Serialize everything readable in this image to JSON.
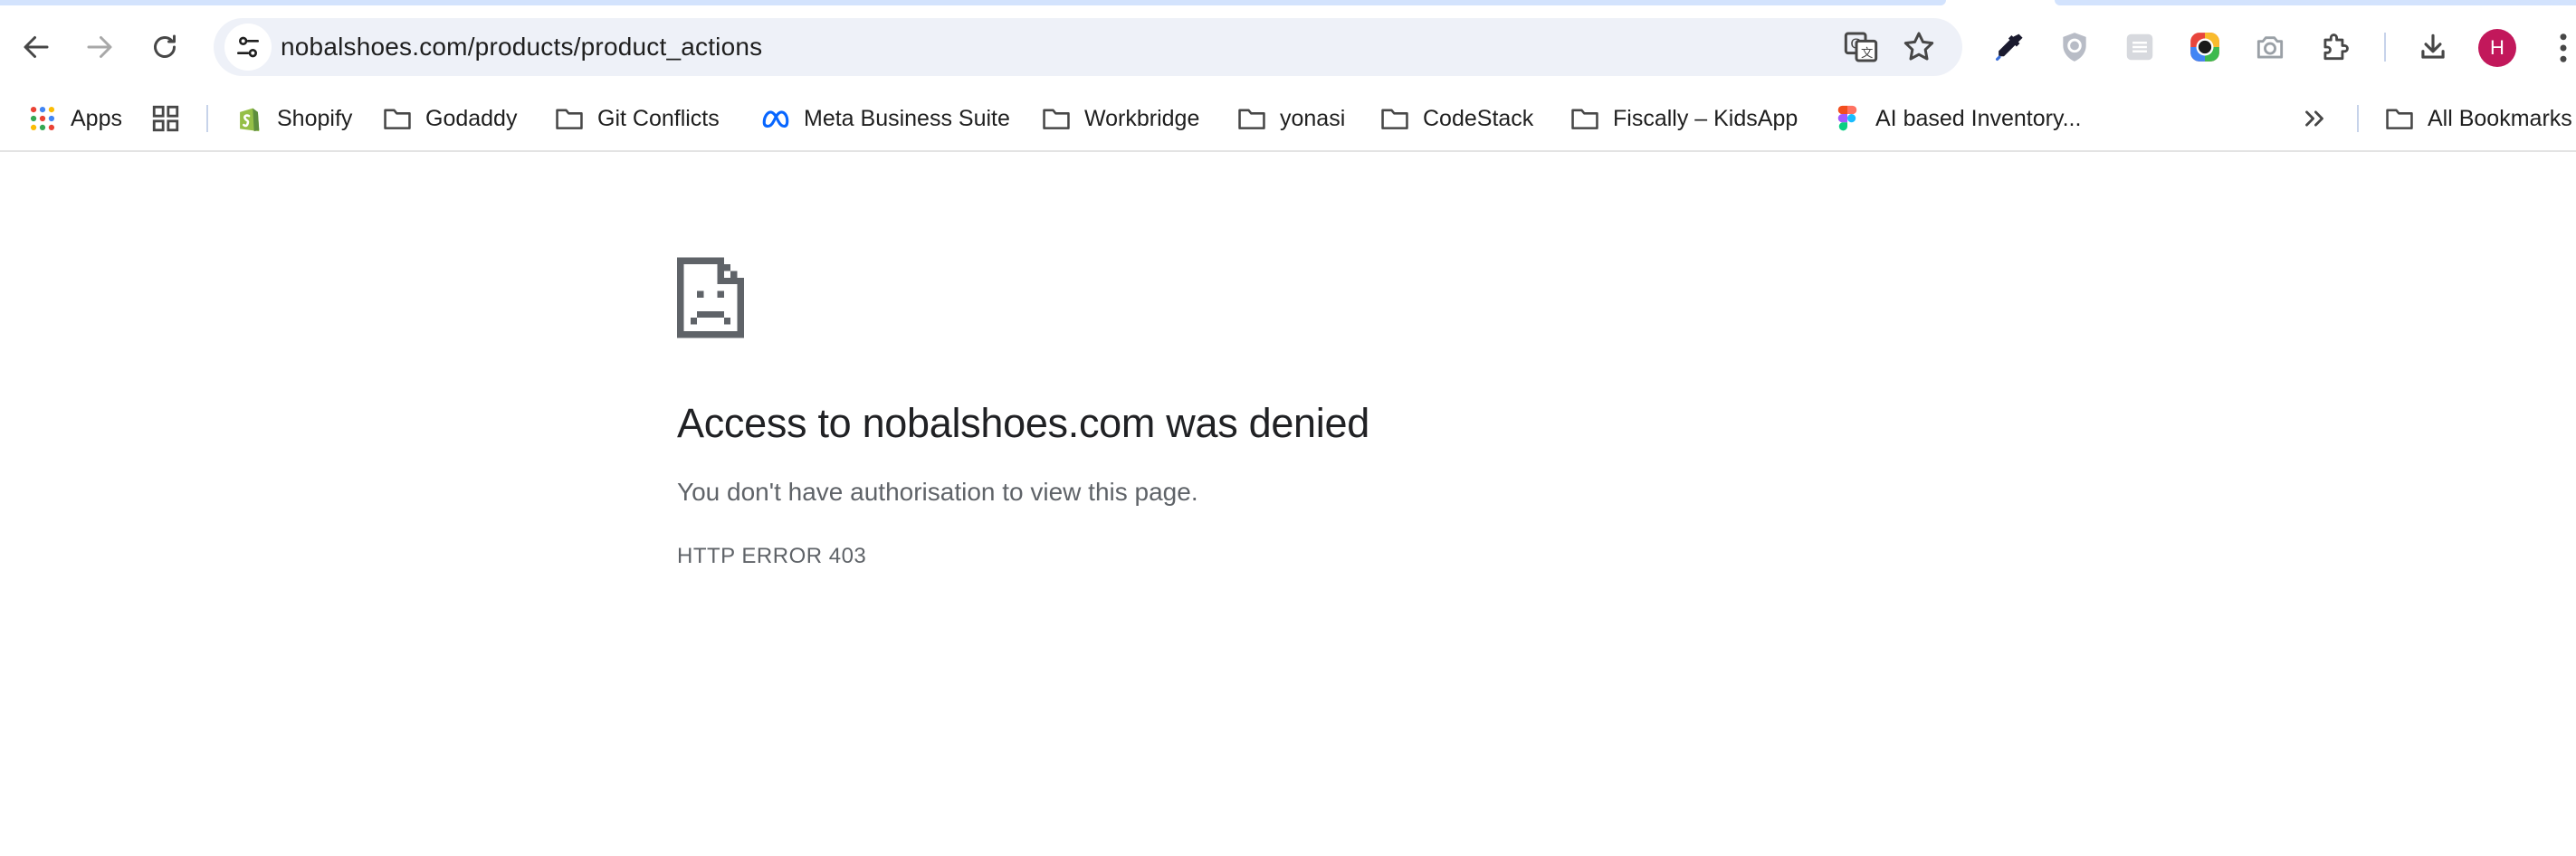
{
  "address_bar": {
    "url": "nobalshoes.com/products/product_actions"
  },
  "profile": {
    "initial": "H"
  },
  "bookmarks": [
    {
      "label": "Apps",
      "icon": "apps-grid-icon"
    },
    {
      "label": "",
      "icon": "tab-groups-icon"
    },
    {
      "label": "Shopify",
      "icon": "shopify-icon"
    },
    {
      "label": "Godaddy",
      "icon": "folder-icon"
    },
    {
      "label": "Git Conflicts",
      "icon": "folder-icon"
    },
    {
      "label": "Meta Business Suite",
      "icon": "meta-icon"
    },
    {
      "label": "Workbridge",
      "icon": "folder-icon"
    },
    {
      "label": "yonasi",
      "icon": "folder-icon"
    },
    {
      "label": "CodeStack",
      "icon": "folder-icon"
    },
    {
      "label": "Fiscally – KidsApp",
      "icon": "folder-icon"
    },
    {
      "label": "AI based Inventory...",
      "icon": "figma-icon"
    },
    {
      "label": "All Bookmarks",
      "icon": "folder-icon"
    }
  ],
  "error_page": {
    "heading": "Access to nobalshoes.com was denied",
    "message": "You don't have authorisation to view this page.",
    "error_code": "HTTP ERROR 403"
  },
  "colors": {
    "omnibox_bg": "#eef1f8",
    "avatar_bg": "#c2185b",
    "heading": "#202124",
    "secondary_text": "#5f6368"
  }
}
